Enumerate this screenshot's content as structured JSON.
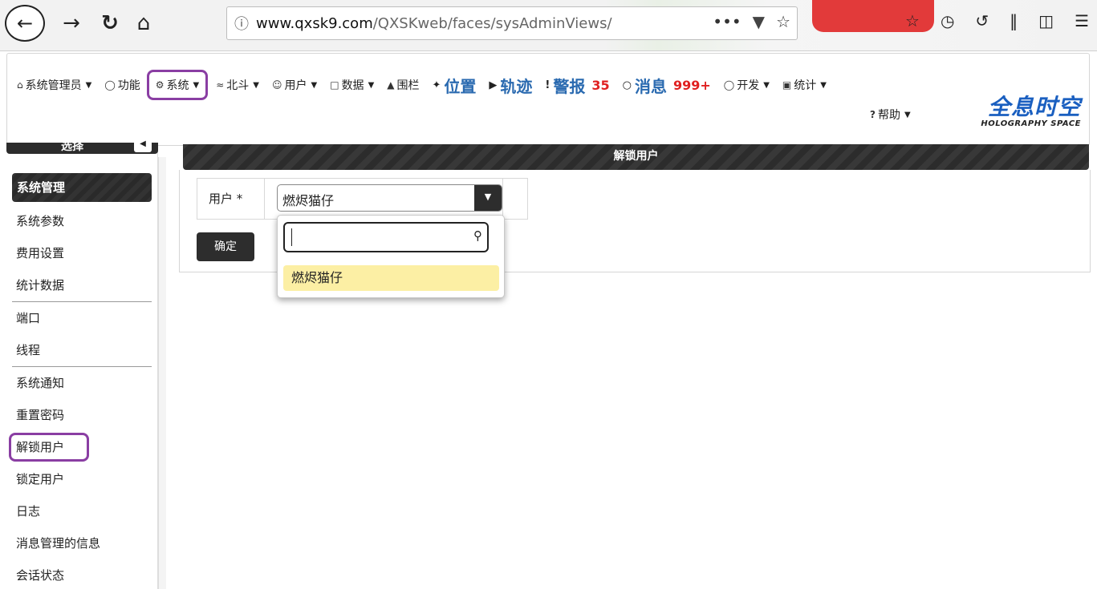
{
  "browser": {
    "url_host": "www.qxsk9.com",
    "url_path": "/QXSKweb/faces/sysAdminViews/",
    "more": "•••"
  },
  "menu": {
    "items": [
      {
        "icon": "⌂",
        "label": "系统管理员",
        "caret": true
      },
      {
        "icon": "⚐",
        "label": "功能",
        "caret": false
      },
      {
        "icon": "⚙",
        "label": "系统",
        "caret": true
      },
      {
        "icon": "≈",
        "label": "北斗",
        "caret": true
      },
      {
        "icon": "☺",
        "label": "用户",
        "caret": true
      },
      {
        "icon": "□",
        "label": "数据",
        "caret": true
      },
      {
        "icon": "▲",
        "label": "围栏",
        "caret": false
      }
    ],
    "position": "位置",
    "track": "轨迹",
    "alarm": "警报",
    "alarm_count": "35",
    "message": "消息",
    "message_count": "999+",
    "dev": "开发",
    "stats": "统计",
    "help": "帮助"
  },
  "logo": {
    "main": "全息时空",
    "sub": "HOLOGRAPHY SPACE"
  },
  "sidebar": {
    "title": "选择",
    "items": [
      {
        "label": "系统管理",
        "active": true
      },
      {
        "label": "系统参数"
      },
      {
        "label": "费用设置"
      },
      {
        "label": "统计数据"
      },
      {
        "label": "端口"
      },
      {
        "label": "线程"
      },
      {
        "label": "系统通知"
      },
      {
        "label": "重置密码"
      },
      {
        "label": "解锁用户",
        "highlighted": true
      },
      {
        "label": "锁定用户"
      },
      {
        "label": "日志"
      },
      {
        "label": "消息管理的信息"
      },
      {
        "label": "会话状态"
      }
    ]
  },
  "panel": {
    "title": "解锁用户",
    "user_label": "用户 *",
    "selected_user": "燃烬猫仔",
    "confirm": "确定",
    "filter_value": "",
    "options": [
      "燃烬猫仔"
    ]
  },
  "colors": {
    "highlight": "#8a3ea3",
    "option_bg": "#fcefa4",
    "dark": "#2d2d2d",
    "link_blue": "#2a6ab0",
    "badge_red": "#e02020"
  }
}
